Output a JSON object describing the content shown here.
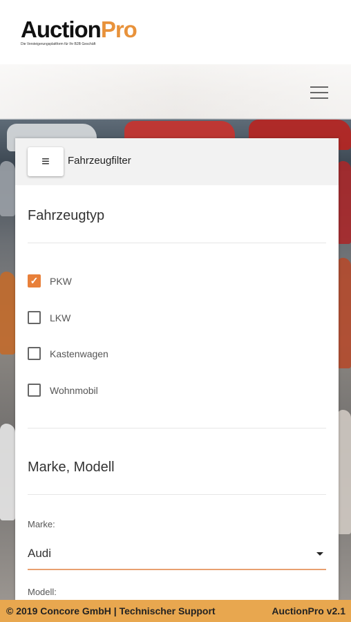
{
  "header": {
    "logo_part1": "Auction",
    "logo_part2": "Pro",
    "tagline": "Die Versteigerungsplattform für Ihr B2B Geschäft"
  },
  "filter_panel": {
    "title": "Fahrzeugfilter",
    "vehicle_type": {
      "title": "Fahrzeugtyp",
      "options": [
        {
          "label": "PKW",
          "checked": true
        },
        {
          "label": "LKW",
          "checked": false
        },
        {
          "label": "Kastenwagen",
          "checked": false
        },
        {
          "label": "Wohnmobil",
          "checked": false
        }
      ]
    },
    "brand_model": {
      "title": "Marke, Modell",
      "brand_label": "Marke:",
      "brand_value": "Audi",
      "model_label": "Modell:"
    }
  },
  "footer": {
    "left": "© 2019 Concore GmbH | Technischer Support",
    "right": "AuctionPro v2.1"
  },
  "colors": {
    "accent": "#e8803a",
    "footer_bg": "#e8a74f"
  },
  "icons": {
    "menu": "hamburger-menu-icon",
    "filter_menu": "hamburger-menu-icon",
    "check": "checkmark-icon",
    "dropdown": "caret-down-icon"
  }
}
